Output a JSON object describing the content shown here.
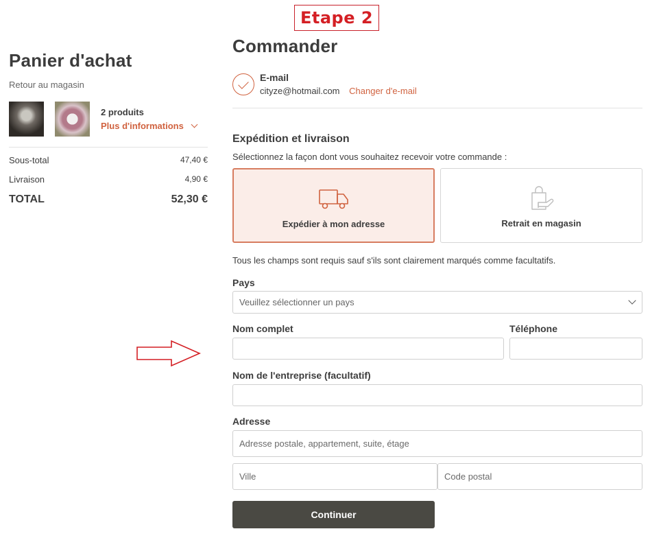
{
  "annotation": {
    "step_label": "Etape 2"
  },
  "cart": {
    "title": "Panier d'achat",
    "back_link": "Retour au magasin",
    "product_count": "2 produits",
    "more_info": "Plus d'informations",
    "subtotal_label": "Sous-total",
    "subtotal_value": "47,40 €",
    "shipping_label": "Livraison",
    "shipping_value": "4,90 €",
    "total_label": "TOTAL",
    "total_value": "52,30 €"
  },
  "checkout": {
    "title": "Commander",
    "email_label": "E-mail",
    "email_value": "cityze@hotmail.com",
    "change_email": "Changer d'e-mail",
    "shipping_title": "Expédition et livraison",
    "shipping_desc": "Sélectionnez la façon dont vous souhaitez recevoir votre commande :",
    "options": [
      {
        "label": "Expédier à mon adresse",
        "icon": "truck-icon",
        "selected": true
      },
      {
        "label": "Retrait en magasin",
        "icon": "store-pickup-icon",
        "selected": false
      }
    ],
    "required_note": "Tous les champs sont requis sauf s'ils sont clairement marqués comme facultatifs.",
    "country_label": "Pays",
    "country_placeholder": "Veuillez sélectionner un pays",
    "full_name_label": "Nom complet",
    "phone_label": "Téléphone",
    "company_label": "Nom de l'entreprise (facultatif)",
    "address_label": "Adresse",
    "address_placeholder": "Adresse postale, appartement, suite, étage",
    "city_placeholder": "Ville",
    "zip_placeholder": "Code postal",
    "continue_label": "Continuer"
  },
  "colors": {
    "accent": "#d0623f",
    "annotation_red": "#d41f24",
    "button_dark": "#4a4943",
    "selected_bg": "#fbede8"
  }
}
